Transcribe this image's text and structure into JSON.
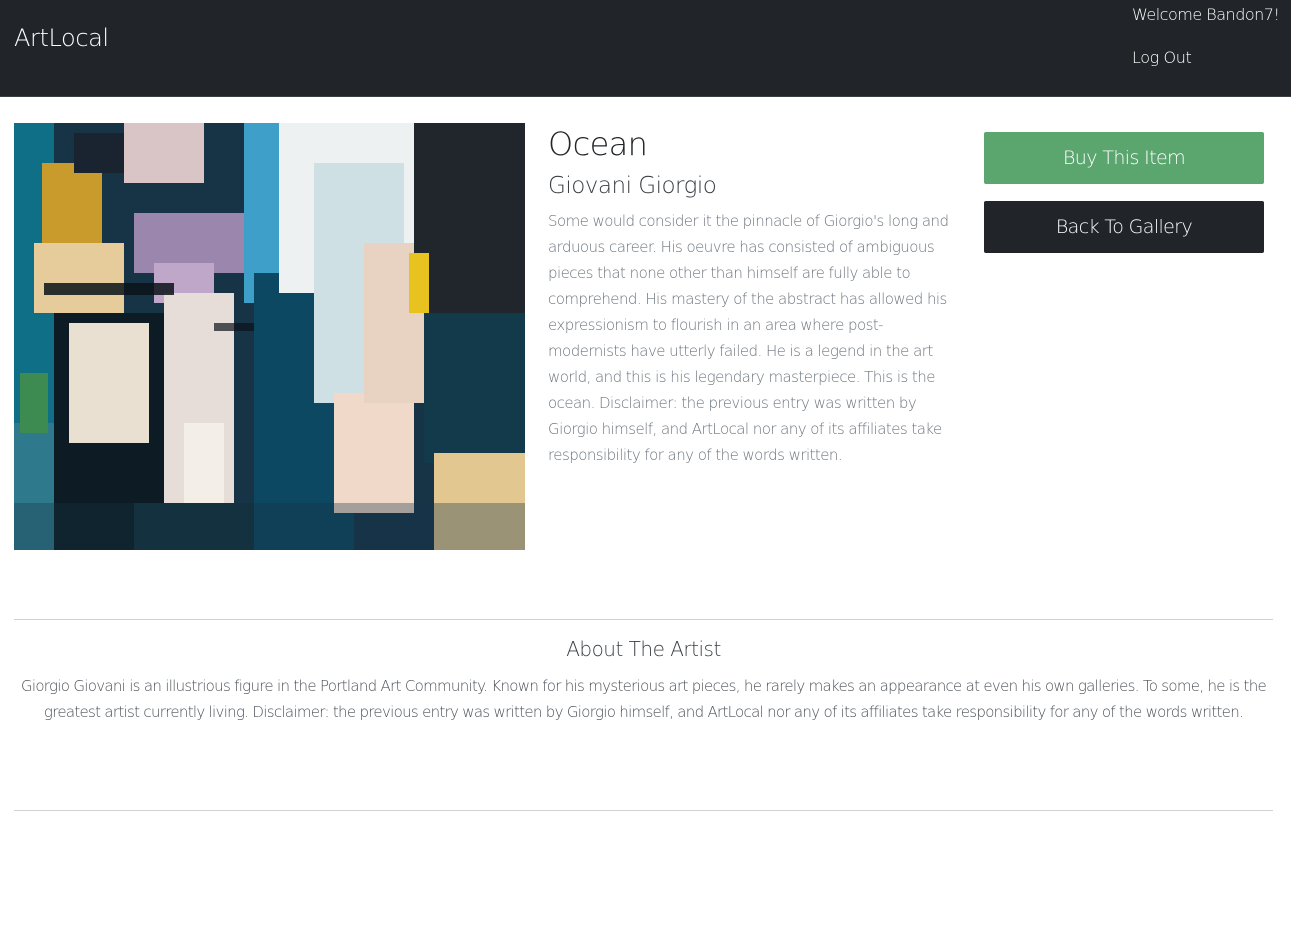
{
  "header": {
    "brand": "ArtLocal",
    "welcome": "Welcome Bandon7!",
    "logout_label": "Log Out"
  },
  "artwork": {
    "title": "Ocean",
    "artist": "Giovani Giorgio",
    "description": "Some would consider it the pinnacle of Giorgio's long and arduous career. His oeuvre has consisted of ambiguous pieces that none other than himself are fully able to comprehend. His mastery of the abstract has allowed his expressionism to flourish in an area where post-modernists have utterly failed. He is a legend in the art world, and this is his legendary masterpiece. This is the ocean. Disclaimer: the previous entry was written by Giorgio himself, and ArtLocal nor any of its affiliates take responsibility for any of the words written."
  },
  "actions": {
    "buy_label": "Buy This Item",
    "back_label": "Back To Gallery"
  },
  "about": {
    "heading": "About The Artist",
    "text": "Giorgio Giovani is an illustrious figure in the Portland Art Community. Known for his mysterious art pieces, he rarely makes an appearance at even his own galleries. To some, he is the greatest artist currently living. Disclaimer: the previous entry was written by Giorgio himself, and ArtLocal nor any of its affiliates take responsibility for any of the words written."
  },
  "colors": {
    "navbar": "#212529",
    "buy_button": "#5ba56f",
    "back_button": "#212529",
    "divider": "#cfd2d5"
  }
}
